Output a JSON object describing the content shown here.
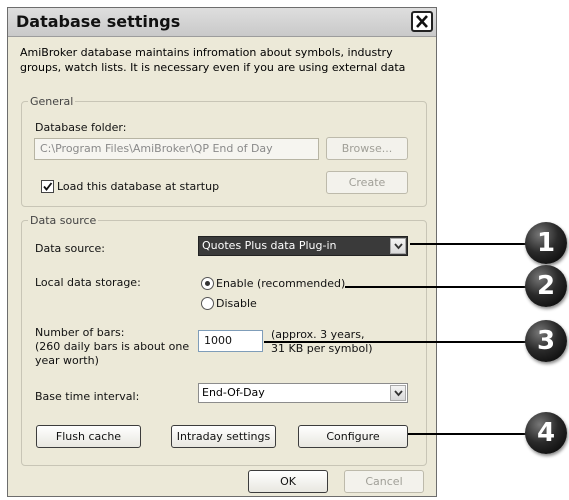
{
  "dialog": {
    "title": "Database settings",
    "intro": "AmiBroker database maintains infromation about symbols, industry groups, watch lists. It is necessary even if you are using external data"
  },
  "general": {
    "legend": "General",
    "folder_label": "Database folder:",
    "folder_value": "C:\\Program Files\\AmiBroker\\QP End of Day",
    "browse_label": "Browse...",
    "load_startup_label": "Load this database at startup",
    "load_startup_checked": true,
    "create_label": "Create"
  },
  "data_source": {
    "legend": "Data source",
    "source_label": "Data source:",
    "source_value": "Quotes Plus data Plug-in",
    "local_storage_label": "Local data storage:",
    "enable_label": "Enable (recommended)",
    "disable_label": "Disable",
    "selected_storage": "Enable (recommended)",
    "bars_label_line1": "Number of bars:",
    "bars_label_line2": "(260 daily bars is about one",
    "bars_label_line3": "year worth)",
    "bars_value": "1000",
    "bars_note_line1": "(approx. 3 years,",
    "bars_note_line2": "31 KB per symbol)",
    "interval_label": "Base time interval:",
    "interval_value": "End-Of-Day",
    "flush_label": "Flush cache",
    "intraday_label": "Intraday settings",
    "configure_label": "Configure"
  },
  "footer": {
    "ok_label": "OK",
    "cancel_label": "Cancel"
  },
  "callouts": [
    "1",
    "2",
    "3",
    "4"
  ]
}
